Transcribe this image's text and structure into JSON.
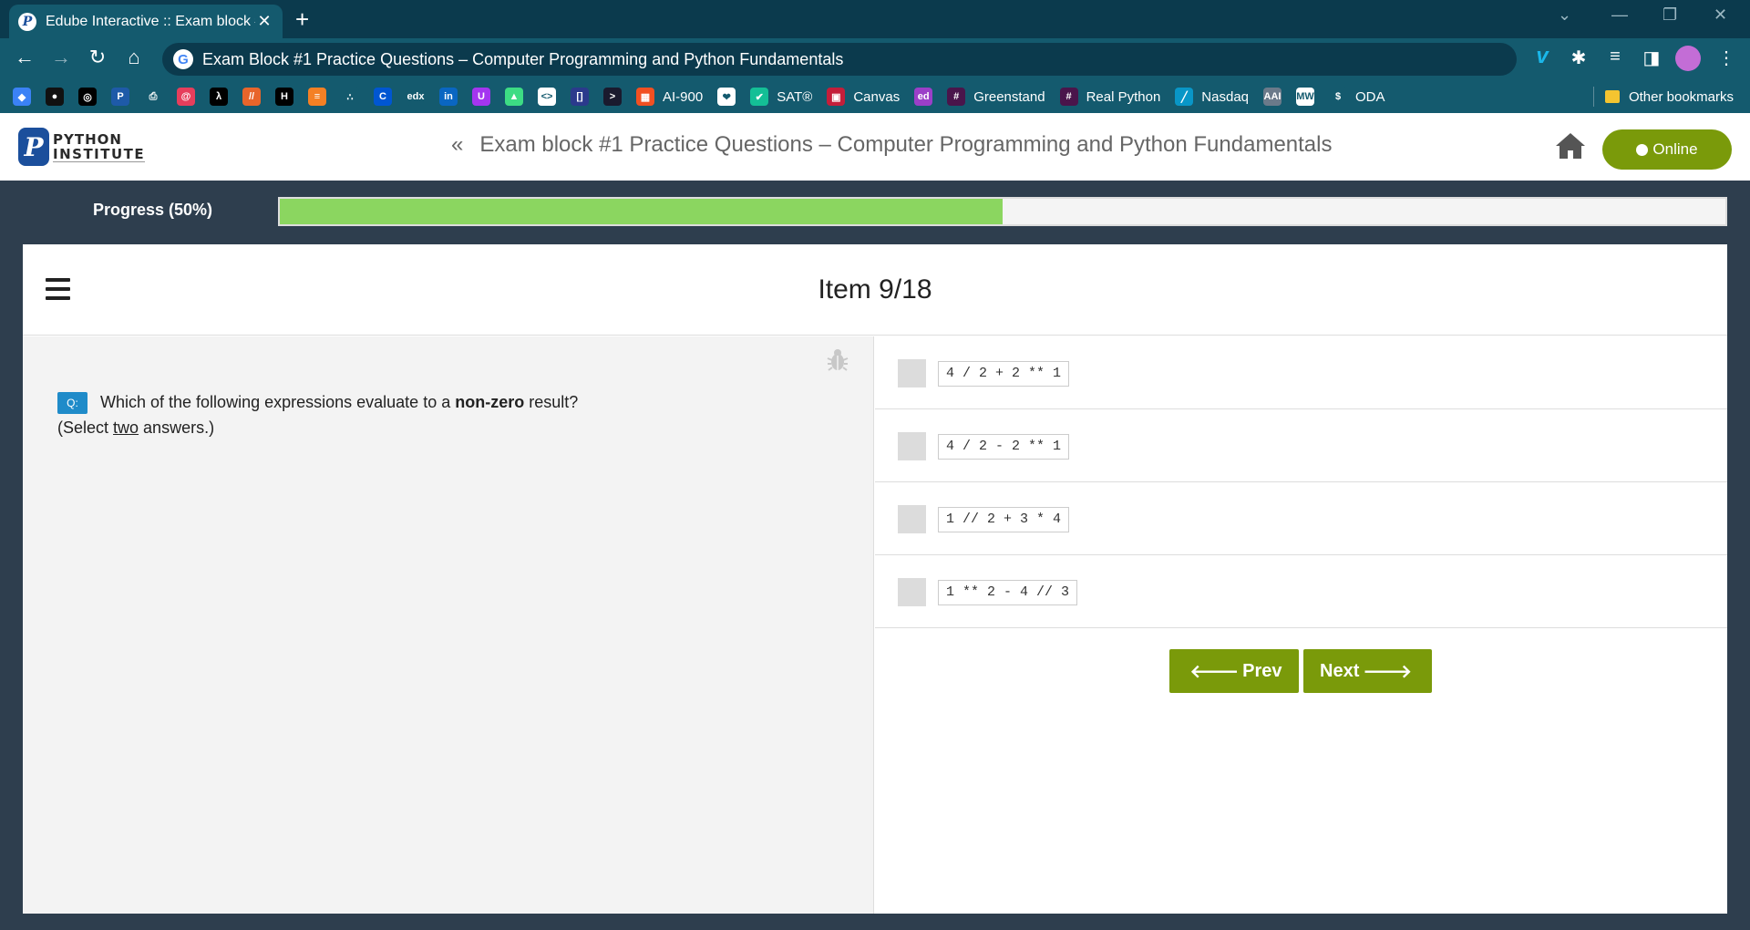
{
  "browser": {
    "tab_title": "Edube Interactive :: Exam block #",
    "url_text": "Exam Block #1 Practice Questions – Computer Programming and Python Fundamentals",
    "bookmarks": [
      {
        "label": "",
        "icon": "layers-icon",
        "color": "#3b82f6",
        "glyph": "◆"
      },
      {
        "label": "",
        "icon": "github-icon",
        "color": "#111111",
        "glyph": "●"
      },
      {
        "label": "",
        "icon": "circle-logo-icon",
        "color": "#000000",
        "glyph": "◎"
      },
      {
        "label": "",
        "icon": "python-icon",
        "color": "#1e5aa8",
        "glyph": "P"
      },
      {
        "label": "",
        "icon": "printer-icon",
        "color": "#145a6e",
        "glyph": "⎙"
      },
      {
        "label": "",
        "icon": "swirl-icon",
        "color": "#e63e5c",
        "glyph": "@"
      },
      {
        "label": "",
        "icon": "lambda-icon",
        "color": "#000000",
        "glyph": "λ"
      },
      {
        "label": "",
        "icon": "slash-icon",
        "color": "#e8652b",
        "glyph": "//"
      },
      {
        "label": "",
        "icon": "hackerrank-icon",
        "color": "#000000",
        "glyph": "H"
      },
      {
        "label": "",
        "icon": "stack-icon",
        "color": "#f48024",
        "glyph": "≡"
      },
      {
        "label": "",
        "icon": "dots-icon",
        "color": "#145a6e",
        "glyph": "∴"
      },
      {
        "label": "",
        "icon": "coursera-icon",
        "color": "#0056d2",
        "glyph": "C"
      },
      {
        "label": "",
        "icon": "edx-icon",
        "color": "#145a6e",
        "glyph": "edx"
      },
      {
        "label": "",
        "icon": "linkedin-icon",
        "color": "#0a66c2",
        "glyph": "in"
      },
      {
        "label": "",
        "icon": "udemy-icon",
        "color": "#a435f0",
        "glyph": "U"
      },
      {
        "label": "",
        "icon": "android-icon",
        "color": "#3ddc84",
        "glyph": "▲"
      },
      {
        "label": "",
        "icon": "code-icon",
        "color": "#ffffff",
        "glyph": "<>"
      },
      {
        "label": "",
        "icon": "brackets-icon",
        "color": "#2b3a8c",
        "glyph": "[]"
      },
      {
        "label": "",
        "icon": "terminal-icon",
        "color": "#1a1a2e",
        "glyph": ">"
      },
      {
        "label": "AI-900",
        "icon": "microsoft-icon",
        "color": "#f25022",
        "glyph": "▦"
      },
      {
        "label": "",
        "icon": "shield-icon",
        "color": "#ffffff",
        "glyph": "❤"
      },
      {
        "label": "SAT®",
        "icon": "khan-icon",
        "color": "#14bf96",
        "glyph": "✔"
      },
      {
        "label": "Canvas",
        "icon": "canvas-icon",
        "color": "#c41e3a",
        "glyph": "▣"
      },
      {
        "label": "",
        "icon": "ed-icon",
        "color": "#9b3fc8",
        "glyph": "ed"
      },
      {
        "label": "Greenstand",
        "icon": "slack-icon",
        "color": "#4a154b",
        "glyph": "#"
      },
      {
        "label": "Real Python",
        "icon": "slack-icon",
        "color": "#4a154b",
        "glyph": "#"
      },
      {
        "label": "Nasdaq",
        "icon": "chart-line-icon",
        "color": "#0996c7",
        "glyph": "╱"
      },
      {
        "label": "",
        "icon": "aai-icon",
        "color": "#6b7a8a",
        "glyph": "AAI"
      },
      {
        "label": "",
        "icon": "mw-icon",
        "color": "#ffffff",
        "glyph": "MW"
      },
      {
        "label": "ODA",
        "icon": "dollar-icon",
        "color": "#145a6e",
        "glyph": "$"
      }
    ],
    "other_bookmarks": "Other bookmarks"
  },
  "site": {
    "logo_line1": "PYTHON",
    "logo_line2": "INSTITUTE",
    "exam_title": "Exam block #1 Practice Questions – Computer Programming and Python Fundamentals",
    "online_label": "Online"
  },
  "progress": {
    "label": "Progress (50%)",
    "percent": 50
  },
  "item": {
    "title": "Item 9/18",
    "question_badge": "Q:",
    "question_pre": "Which of the following expressions evaluate to a ",
    "question_bold": "non-zero",
    "question_post": " result?",
    "select_pre": "(Select ",
    "select_underlined": "two",
    "select_post": " answers.)",
    "answers": [
      "4 / 2 + 2 ** 1",
      "4 / 2 - 2 ** 1",
      "1 // 2 + 3 * 4",
      "1 ** 2 - 4 // 3"
    ],
    "prev_label": "Prev",
    "next_label": "Next"
  },
  "colors": {
    "accent_green": "#7a9a0a",
    "progress_fill": "#8bd660",
    "badge_blue": "#1f8bc9",
    "chrome_dark": "#0b3a4d",
    "chrome": "#145a6e"
  }
}
